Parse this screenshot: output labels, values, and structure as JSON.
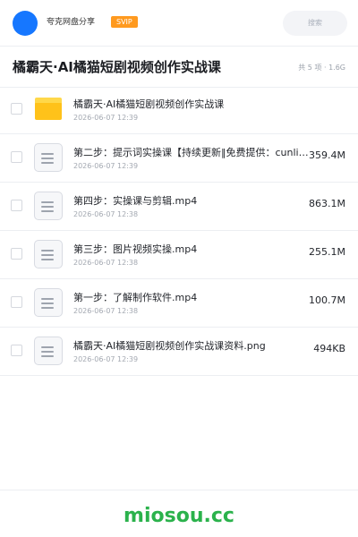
{
  "header": {
    "share_name": "夸克网盘分享",
    "badge": "SVIP",
    "search_placeholder": "搜索"
  },
  "folder": {
    "title": "橘霸天·AI橘猫短剧视频创作实战课",
    "meta": "共 5 项 · 1.6G"
  },
  "files": [
    {
      "name": "橘霸天·AI橘猫短剧视频创作实战课",
      "date": "2026-06-07 12:39",
      "size": "",
      "icon": "folder-icon"
    },
    {
      "name": "第二步：提示词实操课【持续更新‖免费提供：cunlinkshop",
      "date": "2026-06-07 12:39",
      "size": "359.4M",
      "icon": "document-icon"
    },
    {
      "name": "第四步：实操课与剪辑.mp4",
      "date": "2026-06-07 12:38",
      "size": "863.1M",
      "icon": "document-icon"
    },
    {
      "name": "第三步：图片视频实操.mp4",
      "date": "2026-06-07 12:38",
      "size": "255.1M",
      "icon": "document-icon"
    },
    {
      "name": "第一步：了解制作软件.mp4",
      "date": "2026-06-07 12:38",
      "size": "100.7M",
      "icon": "document-icon"
    },
    {
      "name": "橘霸天·AI橘猫短剧视频创作实战课资料.png",
      "date": "2026-06-07 12:39",
      "size": "494KB",
      "icon": "document-icon"
    }
  ],
  "footer": {
    "logo_text": "miosou.cc"
  },
  "colors": {
    "accent": "#1677ff",
    "badge": "#ff9a1f",
    "folder": "#ffc21a",
    "logo": "#2bb24c"
  }
}
